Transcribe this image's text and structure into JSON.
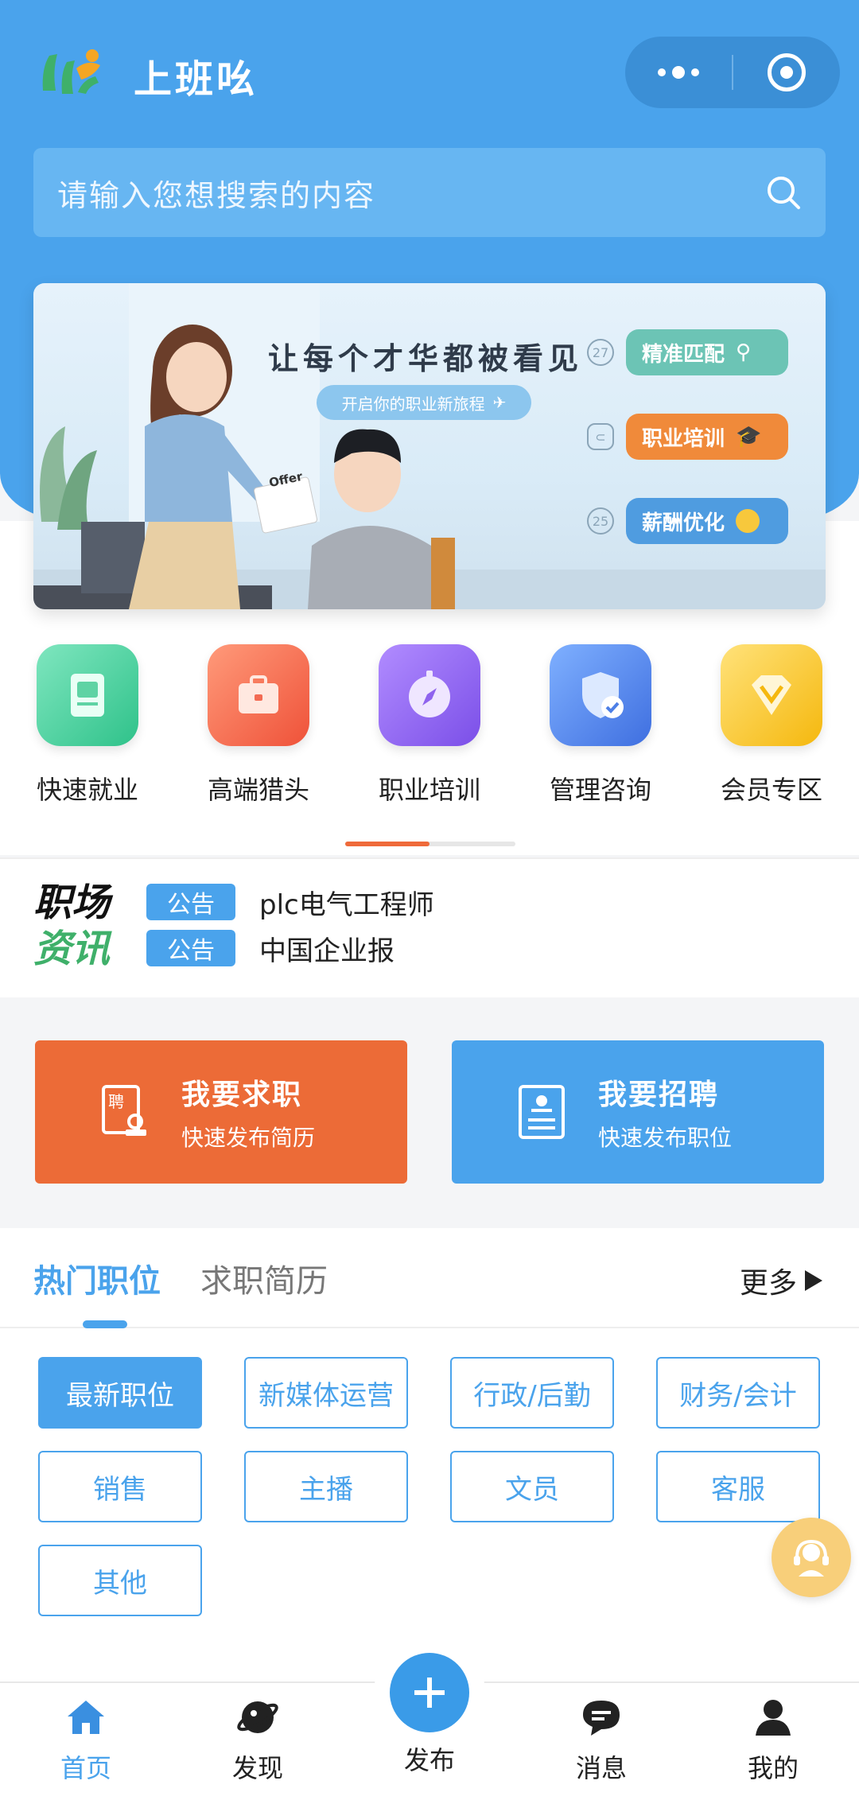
{
  "header": {
    "title": "上班吆",
    "menu_icon": "more-dots-icon",
    "close_icon": "target-icon"
  },
  "search": {
    "placeholder": "请输入您想搜索的内容",
    "icon": "search-icon"
  },
  "banner": {
    "headline": "让每个才华都被看见",
    "subline": "开启你的职业新旅程",
    "paper_label": "Offer",
    "pills": [
      "精准匹配",
      "职业培训",
      "薪酬优化"
    ],
    "marks": [
      "27",
      "25"
    ]
  },
  "categories": [
    {
      "label": "快速就业",
      "icon": "document-icon",
      "color": "#4fd2a0"
    },
    {
      "label": "高端猎头",
      "icon": "briefcase-icon",
      "color": "#f36b53"
    },
    {
      "label": "职业培训",
      "icon": "compass-icon",
      "color": "#8f63ee"
    },
    {
      "label": "管理咨询",
      "icon": "shield-check-icon",
      "color": "#4d7fe6"
    },
    {
      "label": "会员专区",
      "icon": "diamond-icon",
      "color": "#f7c83c"
    }
  ],
  "news": {
    "logo_line1": "职场",
    "logo_line2": "资讯",
    "items": [
      {
        "badge": "公告",
        "text": "plc电气工程师"
      },
      {
        "badge": "公告",
        "text": "中国企业报"
      }
    ]
  },
  "actions": {
    "job_seek": {
      "title": "我要求职",
      "subtitle": "快速发布简历",
      "icon_text": "聘"
    },
    "recruit": {
      "title": "我要招聘",
      "subtitle": "快速发布职位"
    }
  },
  "hot": {
    "tab_active": "热门职位",
    "tab_other": "求职简历",
    "more": "更多",
    "chips": [
      "最新职位",
      "新媒体运营",
      "行政/后勤",
      "财务/会计",
      "销售",
      "主播",
      "文员",
      "客服",
      "其他"
    ],
    "active_chip": "最新职位"
  },
  "tabbar": {
    "home": "首页",
    "discover": "发现",
    "publish": "发布",
    "messages": "消息",
    "mine": "我的"
  },
  "colors": {
    "primary": "#4aa3ec",
    "orange": "#ec6b37",
    "green": "#3fb06a"
  }
}
